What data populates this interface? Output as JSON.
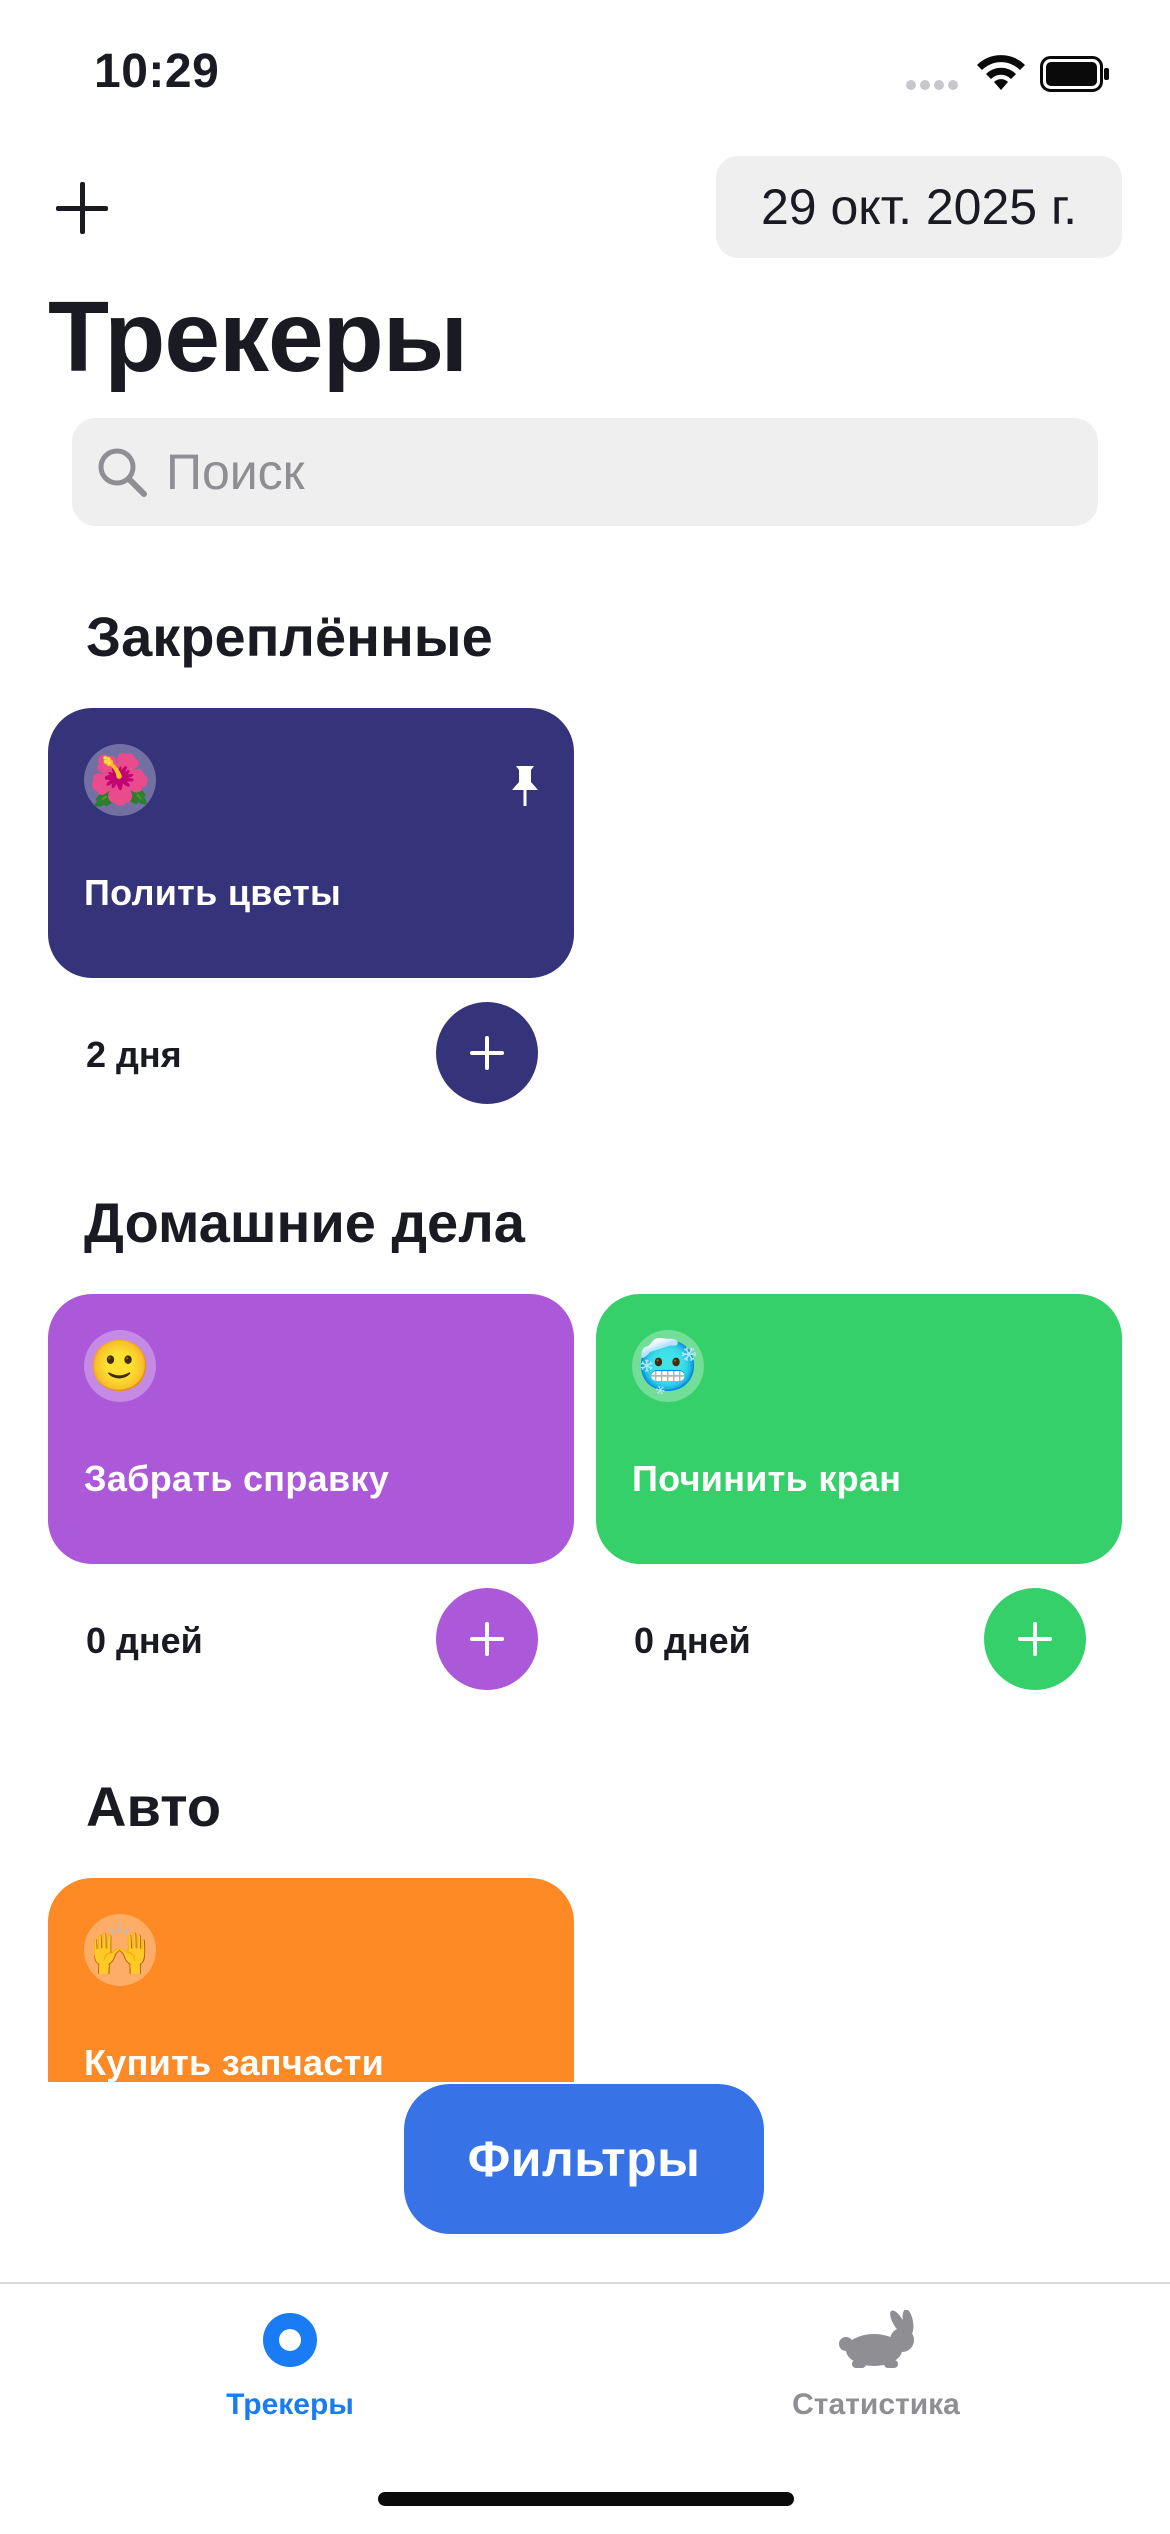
{
  "status_bar": {
    "time": "10:29"
  },
  "header": {
    "date": "29 окт. 2025 г.",
    "title": "Трекеры"
  },
  "search": {
    "placeholder": "Поиск"
  },
  "sections": [
    {
      "title": "Закреплённые",
      "trackers": [
        {
          "emoji": "🌺",
          "name": "Полить цветы",
          "days": "2 дня",
          "color": "#35337a",
          "pinned": true
        }
      ]
    },
    {
      "title": "Домашние дела",
      "trackers": [
        {
          "emoji": "🙂",
          "name": "Забрать справку",
          "days": "0 дней",
          "color": "#ab58d9",
          "pinned": false
        },
        {
          "emoji": "🥶",
          "name": "Починить кран",
          "days": "0 дней",
          "color": "#35d06a",
          "pinned": false
        }
      ]
    },
    {
      "title": "Авто",
      "trackers": [
        {
          "emoji": "🙌",
          "name": "Купить запчасти",
          "color": "#fd8a24",
          "pinned": false
        }
      ]
    }
  ],
  "filters_button": {
    "label": "Фильтры",
    "color": "#3772e7"
  },
  "tab_bar": {
    "tabs": [
      {
        "label": "Трекеры",
        "icon": "trackers-tab-icon",
        "active": true,
        "color": "#1a7cf5"
      },
      {
        "label": "Статистика",
        "icon": "rabbit-icon",
        "active": false,
        "color": "#8e8e93"
      }
    ]
  }
}
